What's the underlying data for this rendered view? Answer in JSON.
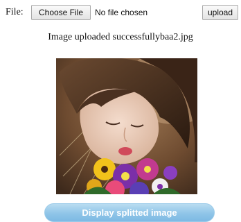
{
  "upload_form": {
    "file_label": "File:",
    "choose_file_label": "Choose File",
    "file_status": "No file chosen",
    "upload_label": "upload"
  },
  "status_message": "Image uploaded successfullybaa2.jpg",
  "preview": {
    "image_description_icon": "uploaded-photo"
  },
  "actions": {
    "display_label": "Display splitted image"
  },
  "colors": {
    "display_button": "#8fc5e8",
    "display_button_text": "#ffffff"
  }
}
